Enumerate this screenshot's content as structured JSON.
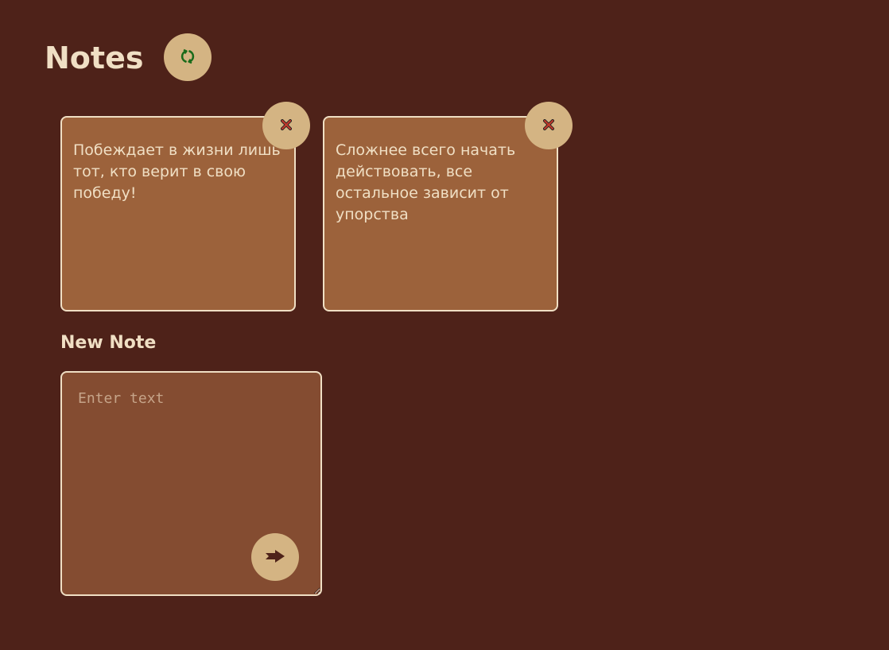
{
  "header": {
    "title": "Notes"
  },
  "notes": [
    {
      "text": "Побеждает в жизни лишь тот, кто верит в свою победу!"
    },
    {
      "text": "Сложнее всего начать действовать, все остальное зависит от упорства"
    }
  ],
  "composer": {
    "label": "New Note",
    "value": "",
    "placeholder": "Enter text"
  },
  "icons": {
    "refresh": "refresh-icon",
    "delete": "close-icon",
    "send": "arrow-right-icon"
  },
  "colors": {
    "background": "#4e2219",
    "note_card": "#9c623b",
    "input_bg": "#844c31",
    "button_bg": "#d4b483",
    "text": "#f0dfc4",
    "refresh_icon": "#1a6b1a",
    "delete_icon": "#c0392b",
    "send_icon": "#4e2219"
  }
}
